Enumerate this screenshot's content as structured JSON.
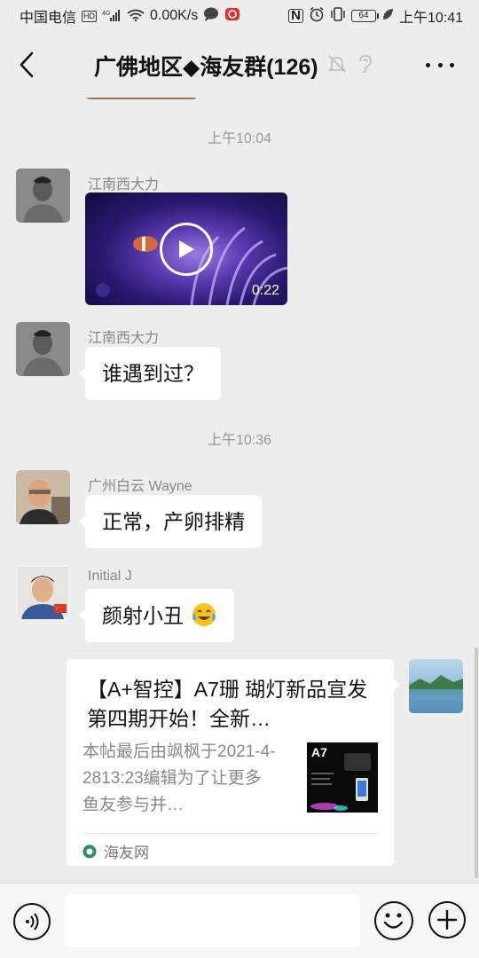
{
  "status_bar": {
    "carrier": "中国电信",
    "net_badge": "HD",
    "net_type": "4G",
    "speed": "0.00K/s",
    "nfc": "N",
    "battery": "64",
    "time": "上午10:41"
  },
  "header": {
    "title": "广佛地区◆海友群(126)"
  },
  "chat": {
    "ts1": "上午10:04",
    "msg1_sender": "江南西大力",
    "video_duration": "0:22",
    "msg2_sender": "江南西大力",
    "msg2_text": "谁遇到过？",
    "ts2": "上午10:36",
    "msg3_sender": "广州白云 Wayne",
    "msg3_text": "正常，产卵排精",
    "msg4_sender": "Initial J",
    "msg4_text": "颜射小丑",
    "card": {
      "title": "【A+智控】A7珊 瑚灯新品宣发 第四期开始！全新…",
      "desc": "本帖最后由飒枫于2021-4-2813:23编辑为了让更多鱼友参与并…",
      "thumb_label": "A7",
      "source": "海友网"
    }
  },
  "input": {
    "placeholder": ""
  }
}
